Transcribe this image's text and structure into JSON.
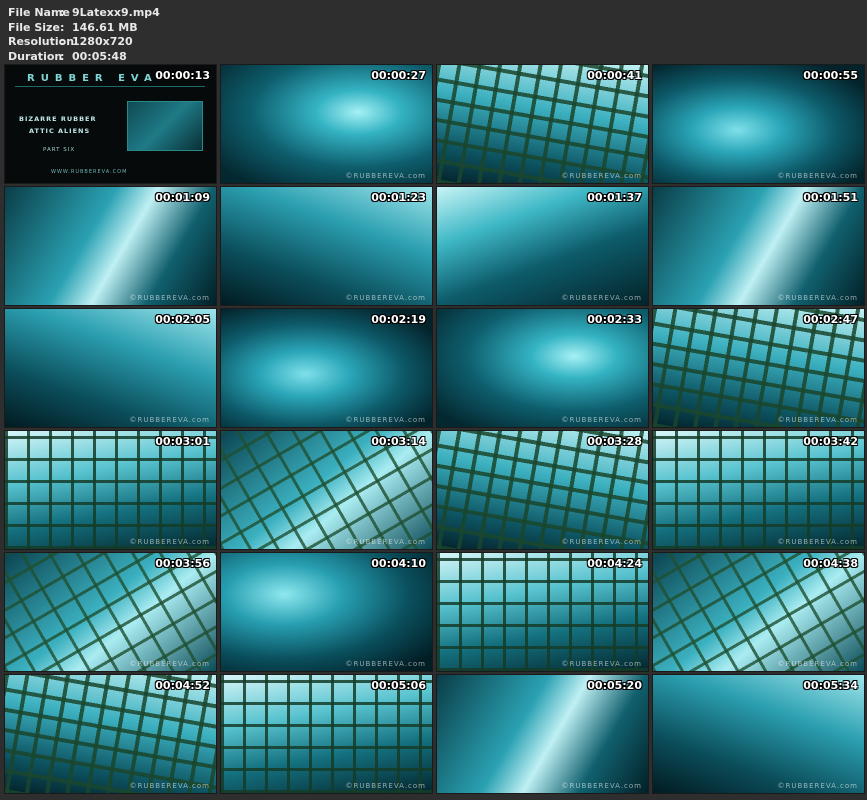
{
  "file_info": {
    "rows": [
      {
        "key": "File Name",
        "value": "9Latexx9.mp4"
      },
      {
        "key": "File Size",
        "value": "146.61 MB"
      },
      {
        "key": "Resolution",
        "value": "1280x720"
      },
      {
        "key": "Duration",
        "value": "00:05:48"
      }
    ],
    "separator": ":"
  },
  "title_card": {
    "logo": "RUBBER EVA",
    "subtitle_1": "BIZARRE RUBBER",
    "subtitle_2": "ATTIC ALIENS",
    "part": "PART SIX",
    "url": "WWW.RUBBEREVA.COM"
  },
  "watermark": "©RUBBEREVA.com",
  "thumbnails": [
    {
      "timestamp": "00:00:13",
      "scene": "title-card"
    },
    {
      "timestamp": "00:00:27",
      "scene": "latex-closeup"
    },
    {
      "timestamp": "00:00:41",
      "scene": "cage-grid"
    },
    {
      "timestamp": "00:00:55",
      "scene": "latex-closeup"
    },
    {
      "timestamp": "00:01:09",
      "scene": "latex-figure"
    },
    {
      "timestamp": "00:01:23",
      "scene": "latex-figure"
    },
    {
      "timestamp": "00:01:37",
      "scene": "latex-figure"
    },
    {
      "timestamp": "00:01:51",
      "scene": "latex-figure"
    },
    {
      "timestamp": "00:02:05",
      "scene": "latex-figure"
    },
    {
      "timestamp": "00:02:19",
      "scene": "latex-closeup"
    },
    {
      "timestamp": "00:02:33",
      "scene": "latex-closeup"
    },
    {
      "timestamp": "00:02:47",
      "scene": "cage-grid"
    },
    {
      "timestamp": "00:03:01",
      "scene": "cage-grid"
    },
    {
      "timestamp": "00:03:14",
      "scene": "cage-grid"
    },
    {
      "timestamp": "00:03:28",
      "scene": "cage-grid"
    },
    {
      "timestamp": "00:03:42",
      "scene": "cage-grid"
    },
    {
      "timestamp": "00:03:56",
      "scene": "cage-grid"
    },
    {
      "timestamp": "00:04:10",
      "scene": "latex-closeup"
    },
    {
      "timestamp": "00:04:24",
      "scene": "cage-grid"
    },
    {
      "timestamp": "00:04:38",
      "scene": "cage-grid"
    },
    {
      "timestamp": "00:04:52",
      "scene": "cage-grid"
    },
    {
      "timestamp": "00:05:06",
      "scene": "cage-grid"
    },
    {
      "timestamp": "00:05:20",
      "scene": "latex-figure"
    },
    {
      "timestamp": "00:05:34",
      "scene": "latex-figure"
    }
  ]
}
